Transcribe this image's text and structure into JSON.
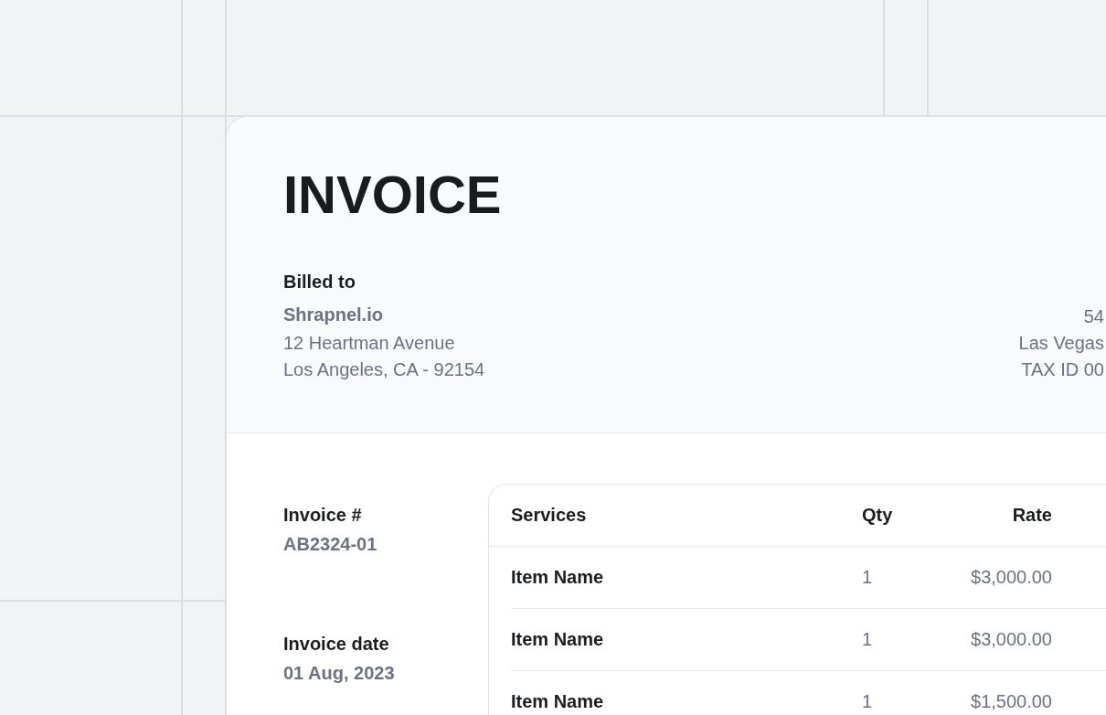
{
  "invoice": {
    "title": "INVOICE",
    "billed_to": {
      "label": "Billed to",
      "name": "Shrapnel.io",
      "address_lines": [
        "12 Heartman Avenue",
        "Los Angeles, CA - 92154"
      ]
    },
    "sender_lines": [
      "54",
      "Las Vegas",
      "TAX ID 00"
    ]
  },
  "details": [
    {
      "label": "Invoice #",
      "value": "AB2324-01"
    },
    {
      "label": "Invoice date",
      "value": "01 Aug, 2023"
    }
  ],
  "table": {
    "columns": [
      "Services",
      "Qty",
      "Rate"
    ],
    "rows": [
      {
        "service": "Item Name",
        "qty": "1",
        "rate": "$3,000.00"
      },
      {
        "service": "Item Name",
        "qty": "1",
        "rate": "$3,000.00"
      },
      {
        "service": "Item Name",
        "qty": "1",
        "rate": "$1,500.00"
      }
    ]
  }
}
